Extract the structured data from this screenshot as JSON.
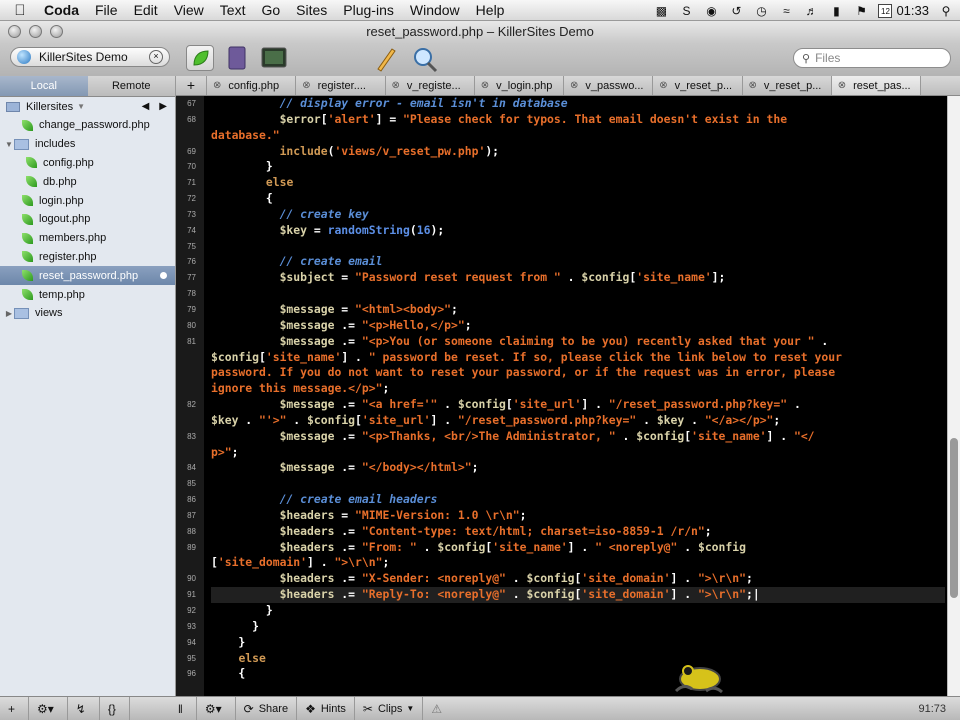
{
  "menubar": {
    "app_name": "Coda",
    "items": [
      "File",
      "Edit",
      "View",
      "Text",
      "Go",
      "Sites",
      "Plug-ins",
      "Window",
      "Help"
    ],
    "clock": "01:33",
    "status_icons": [
      "camera-icon",
      "skype-icon",
      "coda-icon",
      "time-machine-icon",
      "clock-icon",
      "wifi-icon",
      "volume-icon",
      "battery-icon",
      "flag-icon"
    ]
  },
  "window": {
    "title": "reset_password.php – KillerSites Demo",
    "site_name": "KillerSites Demo",
    "search_placeholder": "Files"
  },
  "sidebar": {
    "tabs": [
      "Local",
      "Remote"
    ],
    "site_folder": "Killersites",
    "files": [
      {
        "name": "change_password.php",
        "kind": "file",
        "indent": 0
      },
      {
        "name": "includes",
        "kind": "folder",
        "indent": 0
      },
      {
        "name": "config.php",
        "kind": "file",
        "indent": 1
      },
      {
        "name": "db.php",
        "kind": "file",
        "indent": 1
      },
      {
        "name": "login.php",
        "kind": "file",
        "indent": 0
      },
      {
        "name": "logout.php",
        "kind": "file",
        "indent": 0
      },
      {
        "name": "members.php",
        "kind": "file",
        "indent": 0
      },
      {
        "name": "register.php",
        "kind": "file",
        "indent": 0
      },
      {
        "name": "reset_password.php",
        "kind": "file",
        "indent": 0,
        "selected": true
      },
      {
        "name": "temp.php",
        "kind": "file",
        "indent": 0
      },
      {
        "name": "views",
        "kind": "folder",
        "indent": 0
      }
    ]
  },
  "tabs": [
    "config.php",
    "register....",
    "v_registe...",
    "v_login.php",
    "v_passwo...",
    "v_reset_p...",
    "v_reset_p...",
    "reset_pas..."
  ],
  "active_tab": 7,
  "bottombar": {
    "share": "Share",
    "hints": "Hints",
    "clips": "Clips",
    "cursor_position": "91:73"
  },
  "editor": {
    "line_numbers": [
      "67",
      "68",
      "",
      "69",
      "70",
      "71",
      "72",
      "73",
      "74",
      "75",
      "76",
      "77",
      "78",
      "79",
      "80",
      "81",
      "",
      "",
      "",
      "82",
      "",
      "83",
      "",
      "84",
      "85",
      "86",
      "87",
      "88",
      "89",
      "",
      "90",
      "91",
      "92",
      "93",
      "94",
      "95",
      "96"
    ],
    "current_line_index": 31
  }
}
